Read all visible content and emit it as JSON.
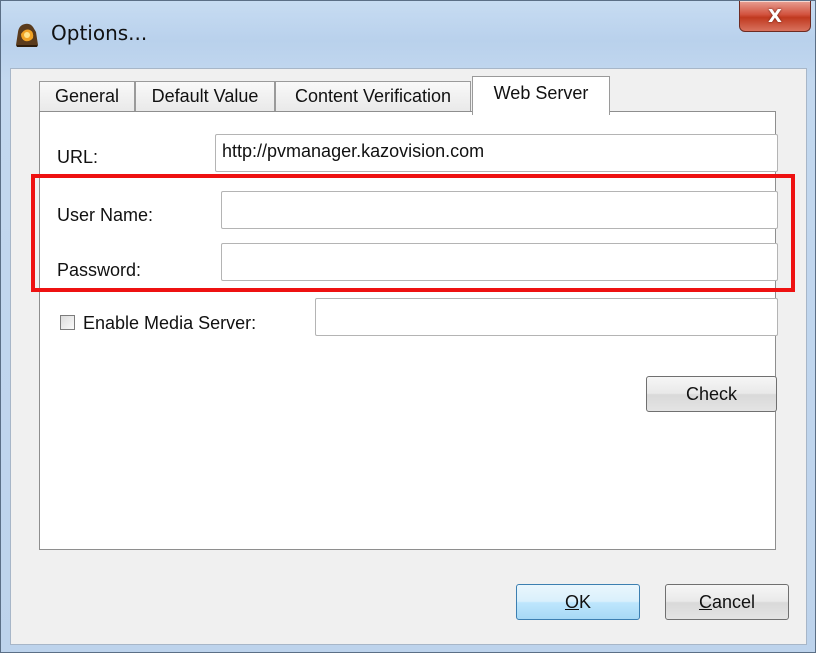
{
  "window": {
    "title": "Options...",
    "close_glyph": "X"
  },
  "tabs": [
    {
      "label": "General",
      "active": false
    },
    {
      "label": "Default Value",
      "active": false
    },
    {
      "label": "Content Verification",
      "active": false
    },
    {
      "label": "Web Server",
      "active": true
    }
  ],
  "web_server": {
    "url_label": "URL:",
    "url_value": "http://pvmanager.kazovision.com",
    "username_label": "User Name:",
    "username_value": "",
    "password_label": "Password:",
    "password_value": "",
    "media_server_label": "Enable Media Server:",
    "media_server_checked": false,
    "media_server_value": "",
    "check_label": "Check"
  },
  "footer": {
    "ok_mnemonic": "O",
    "ok_rest": "K",
    "cancel_mnemonic": "C",
    "cancel_rest": "ancel"
  },
  "colors": {
    "highlight": "#ee1111",
    "default_button_border": "#3c7fb1"
  }
}
